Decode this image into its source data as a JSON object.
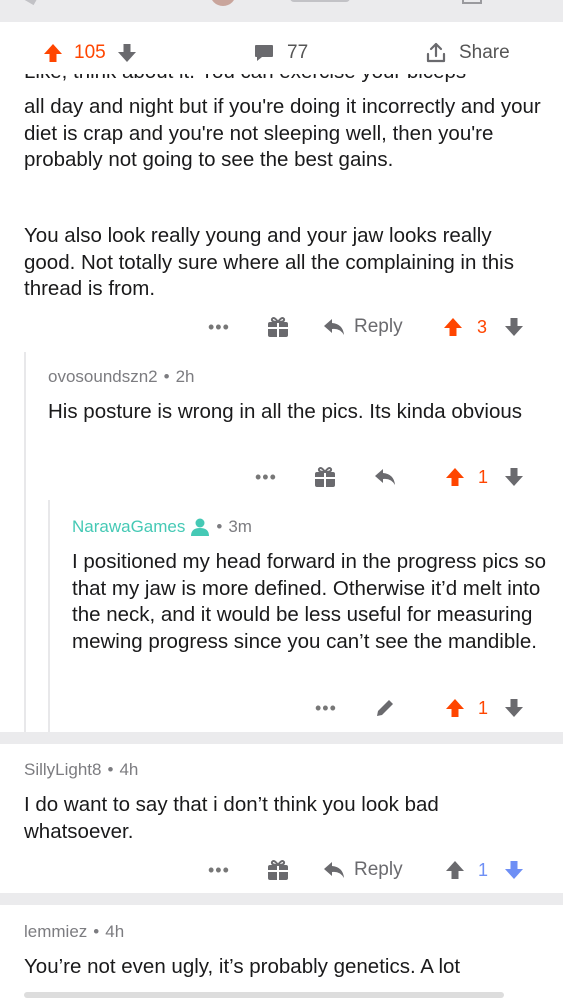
{
  "post": {
    "score": "105",
    "comment_count": "77",
    "share_label": "Share"
  },
  "op_comment": {
    "clipped_line": "Like, think about it. You can exercise your biceps",
    "paragraph_1": "all day and night but if you're doing it incorrectly and your diet is crap and you're not sleeping well, then you're probably not going to see the best gains.",
    "paragraph_2": "You also look really young and your jaw looks really good. Not totally sure where all the complaining in this thread is from.",
    "reply_label": "Reply",
    "score": "3",
    "more_label": "•••"
  },
  "reply_1": {
    "username": "ovosoundszn2",
    "age": "2h",
    "text": "His posture is wrong in all the pics. Its kinda obvious",
    "score": "1",
    "more_label": "•••"
  },
  "reply_2": {
    "username": "NarawaGames",
    "age": "3m",
    "text": "I positioned my head forward in the progress pics so that my jaw is more defined. Otherwise it’d melt into the neck, and it would be less useful for measuring mewing progress since you can’t see the mandible.",
    "score": "1",
    "more_label": "•••"
  },
  "comment_2": {
    "username": "SillyLight8",
    "age": "4h",
    "text": "I do want to say that i don’t think you look bad whatsoever.",
    "reply_label": "Reply",
    "score": "1",
    "more_label": "•••"
  },
  "comment_3": {
    "username": "lemmiez",
    "age": "4h",
    "text": "You’re not even ugly, it’s probably genetics. A lot"
  },
  "separator": "•",
  "colors": {
    "upvote": "#ff4500",
    "downvote_active": "#6e8ff5",
    "op_user": "#45c9b5",
    "icon_gray": "#6a6a6e",
    "divider": "#ebebed"
  }
}
